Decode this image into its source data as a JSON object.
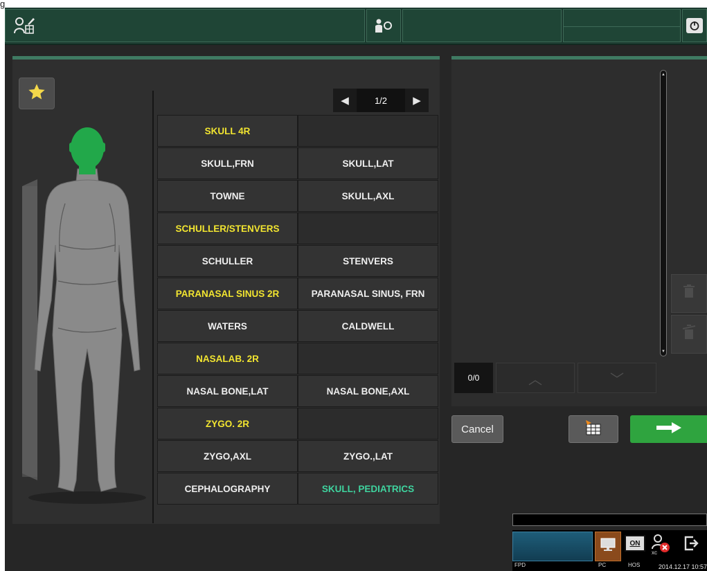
{
  "corner_label": "g",
  "pager": {
    "text": "1/2"
  },
  "exam_grid": [
    {
      "label": "SKULL 4R",
      "style": "yellow"
    },
    {
      "label": "",
      "style": "empty"
    },
    {
      "label": "SKULL,FRN",
      "style": "white"
    },
    {
      "label": "SKULL,LAT",
      "style": "white"
    },
    {
      "label": "TOWNE",
      "style": "white"
    },
    {
      "label": "SKULL,AXL",
      "style": "white"
    },
    {
      "label": "SCHULLER/STENVERS",
      "style": "yellow"
    },
    {
      "label": "",
      "style": "empty"
    },
    {
      "label": "SCHULLER",
      "style": "white"
    },
    {
      "label": "STENVERS",
      "style": "white"
    },
    {
      "label": "PARANASAL SINUS 2R",
      "style": "yellow"
    },
    {
      "label": "PARANASAL SINUS, FRN",
      "style": "white"
    },
    {
      "label": "WATERS",
      "style": "white"
    },
    {
      "label": "CALDWELL",
      "style": "white"
    },
    {
      "label": "NASALAB. 2R",
      "style": "yellow"
    },
    {
      "label": "",
      "style": "empty"
    },
    {
      "label": "NASAL BONE,LAT",
      "style": "white"
    },
    {
      "label": "NASAL BONE,AXL",
      "style": "white"
    },
    {
      "label": "ZYGO. 2R",
      "style": "yellow"
    },
    {
      "label": "",
      "style": "empty"
    },
    {
      "label": "ZYGO,AXL",
      "style": "white"
    },
    {
      "label": "ZYGO.,LAT",
      "style": "white"
    },
    {
      "label": "CEPHALOGRAPHY",
      "style": "white"
    },
    {
      "label": "SKULL, PEDIATRICS",
      "style": "green"
    }
  ],
  "counter": {
    "text": "0/0"
  },
  "actions": {
    "cancel_label": "Cancel"
  },
  "status": {
    "fpd_label": "FPD",
    "pc_label": "PC",
    "hos_label": "HOS",
    "on_label": "ON",
    "xc_label": "xc",
    "datetime": "2014.12.17 10:57"
  },
  "colors": {
    "header": "#1b3a2f",
    "panel_accent": "#3f7a62",
    "label_yellow": "#f2e530",
    "label_green": "#3fd49f",
    "next_button": "#2fa43f",
    "head_highlight": "#22a84a"
  },
  "icons": {
    "patient_edit": "patient-edit-icon",
    "operator": "operator-icon",
    "power": "power-icon",
    "favorite": "star-icon",
    "table": "table-import-icon",
    "next": "arrow-right-icon"
  }
}
